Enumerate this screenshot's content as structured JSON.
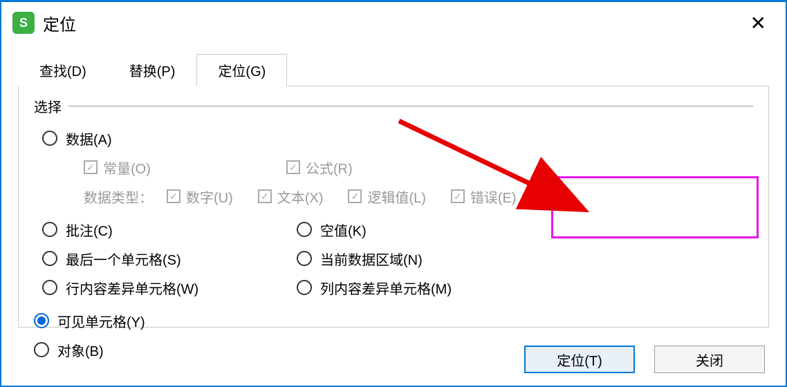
{
  "title": "定位",
  "app_icon_letter": "S",
  "close_symbol": "✕",
  "tabs": {
    "find": "查找(D)",
    "replace": "替换(P)",
    "goto": "定位(G)"
  },
  "section_label": "选择",
  "options": {
    "data": "数据(A)",
    "constant": "常量(O)",
    "formula": "公式(R)",
    "data_type_label": "数据类型：",
    "number": "数字(U)",
    "text": "文本(X)",
    "logical": "逻辑值(L)",
    "error": "错误(E)",
    "comment": "批注(C)",
    "blank": "空值(K)",
    "visible_cells": "可见单元格(Y)",
    "last_cell": "最后一个单元格(S)",
    "current_region": "当前数据区域(N)",
    "object": "对象(B)",
    "row_diff": "行内容差异单元格(W)",
    "col_diff": "列内容差异单元格(M)"
  },
  "buttons": {
    "locate": "定位(T)",
    "close": "关闭"
  },
  "checkmark": "✓",
  "selected_option": "visible_cells"
}
